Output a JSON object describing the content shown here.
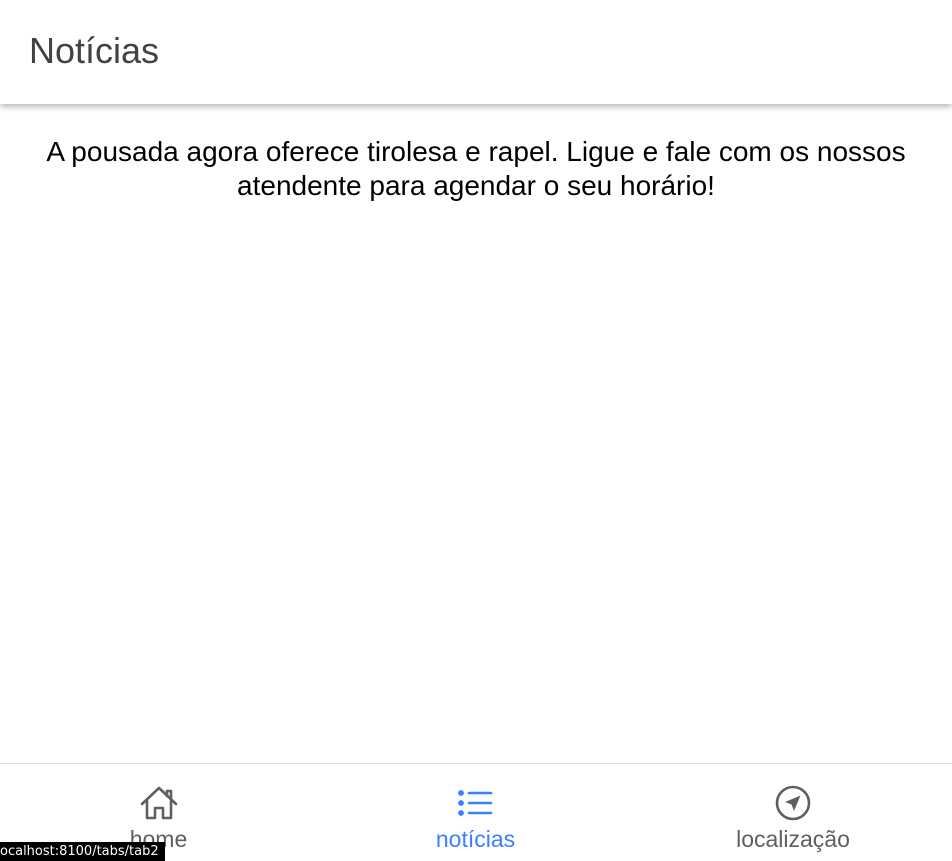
{
  "header": {
    "title": "Notícias"
  },
  "content": {
    "news_text": "A pousada agora oferece tirolesa e rapel. Ligue e fale com os nossos atendente para agendar o seu horário!"
  },
  "tabs": [
    {
      "label": "home",
      "icon": "home-icon",
      "selected": false
    },
    {
      "label": "notícias",
      "icon": "list-icon",
      "selected": true
    },
    {
      "label": "localização",
      "icon": "navigate-icon",
      "selected": false
    }
  ],
  "status_bar": {
    "url": "ocalhost:8100/tabs/tab2"
  },
  "colors": {
    "accent": "#3880ff",
    "tab_inactive": "#5f5f5f",
    "title": "#424242"
  }
}
